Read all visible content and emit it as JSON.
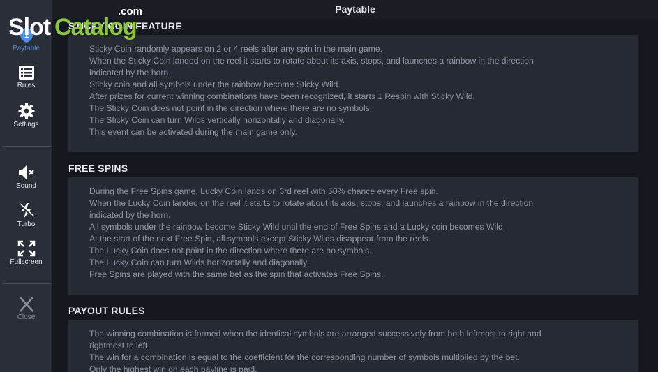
{
  "header": {
    "title": "Paytable"
  },
  "logo": {
    "slot": "Slot",
    "catalog": "Catalog",
    "com": ".com"
  },
  "sidebar": {
    "items": [
      {
        "label": "Paytable",
        "icon": "shield-icon"
      },
      {
        "label": "Rules",
        "icon": "rules-icon"
      },
      {
        "label": "Settings",
        "icon": "gear-icon"
      },
      {
        "label": "Sound",
        "icon": "sound-muted-icon"
      },
      {
        "label": "Turbo",
        "icon": "lightning-icon"
      },
      {
        "label": "Fullscreen",
        "icon": "fullscreen-icon"
      },
      {
        "label": "Close",
        "icon": "close-icon"
      }
    ]
  },
  "colors": {
    "accent": "#4f8fe0",
    "logo_green": "#8cc63f",
    "panel": "#262a33",
    "sidebar": "#2a2e38"
  },
  "sections": [
    {
      "title": "STICKY COIN FEATURE",
      "lines": [
        "Sticky Coin randomly appears on 2 or 4 reels after any spin in the main game.",
        "When the Sticky Coin landed on the reel it starts to rotate about its axis, stops, and launches a rainbow in the direction",
        "indicated by the horn.",
        "Sticky coin and all symbols under the rainbow become Sticky Wild.",
        "After prizes for current winning combinations have been recognized, it starts 1 Respin with Sticky Wild.",
        "The Sticky Coin does not point in the direction where there are no symbols.",
        "The Sticky Coin can turn Wilds vertically horizontally and diagonally.",
        "This event can be activated during the main game only."
      ]
    },
    {
      "title": "FREE SPINS",
      "lines": [
        "During the Free Spins game, Lucky Coin lands on 3rd reel with 50% chance every Free spin.",
        "When the Lucky Coin landed on the reel it starts to rotate about its axis, stops, and launches a rainbow in the direction",
        "indicated by the horn.",
        "All symbols under the rainbow become Sticky Wild until the end of Free Spins and a Lucky coin becomes Wild.",
        "At the start of the next Free Spin, all symbols except Sticky Wilds disappear from the reels.",
        "The Lucky Coin does not point in the direction where there are no symbols.",
        "The Lucky Coin can turn Wilds horizontally and diagonally.",
        "Free Spins are played with the same bet as the spin that activates Free Spins."
      ]
    },
    {
      "title": "PAYOUT RULES",
      "lines": [
        "The winning combination is formed when the identical symbols are arranged successively from both leftmost to right and",
        "rightmost to left.",
        "The win for a combination is equal to the coefficient for the corresponding number of symbols multiplied by the bet.",
        "Only the highest win on each payline is paid."
      ]
    }
  ]
}
